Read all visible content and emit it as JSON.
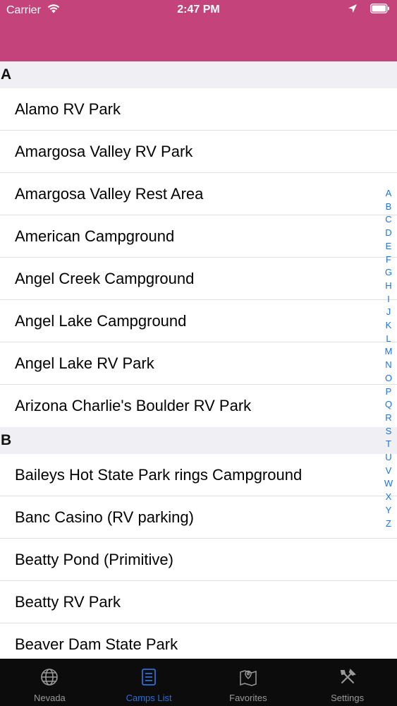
{
  "status": {
    "carrier": "Carrier",
    "time": "2:47 PM"
  },
  "sections": [
    {
      "letter": "A",
      "items": [
        "Alamo RV Park",
        "Amargosa Valley RV Park",
        "Amargosa Valley Rest Area",
        "American Campground",
        "Angel Creek Campground",
        "Angel Lake Campground",
        "Angel Lake RV Park",
        "Arizona Charlie's Boulder RV Park"
      ]
    },
    {
      "letter": "B",
      "items": [
        "Baileys Hot State Park rings Campground",
        "Banc Casino (RV parking)",
        "Beatty Pond (Primitive)",
        "Beatty RV Park",
        "Beaver Dam State Park"
      ]
    }
  ],
  "index_letters": [
    "A",
    "B",
    "C",
    "D",
    "E",
    "F",
    "G",
    "H",
    "I",
    "J",
    "K",
    "L",
    "M",
    "N",
    "O",
    "P",
    "Q",
    "R",
    "S",
    "T",
    "U",
    "V",
    "W",
    "X",
    "Y",
    "Z"
  ],
  "tabs": [
    {
      "label": "Nevada",
      "icon": "globe-icon",
      "active": false
    },
    {
      "label": "Camps List",
      "icon": "list-icon",
      "active": true
    },
    {
      "label": "Favorites",
      "icon": "map-pin-icon",
      "active": false
    },
    {
      "label": "Settings",
      "icon": "tools-icon",
      "active": false
    }
  ],
  "colors": {
    "header": "#c4437a",
    "tab_active": "#2c6fd6",
    "tab_inactive": "#9a9a9a",
    "index": "#1a73e8"
  }
}
